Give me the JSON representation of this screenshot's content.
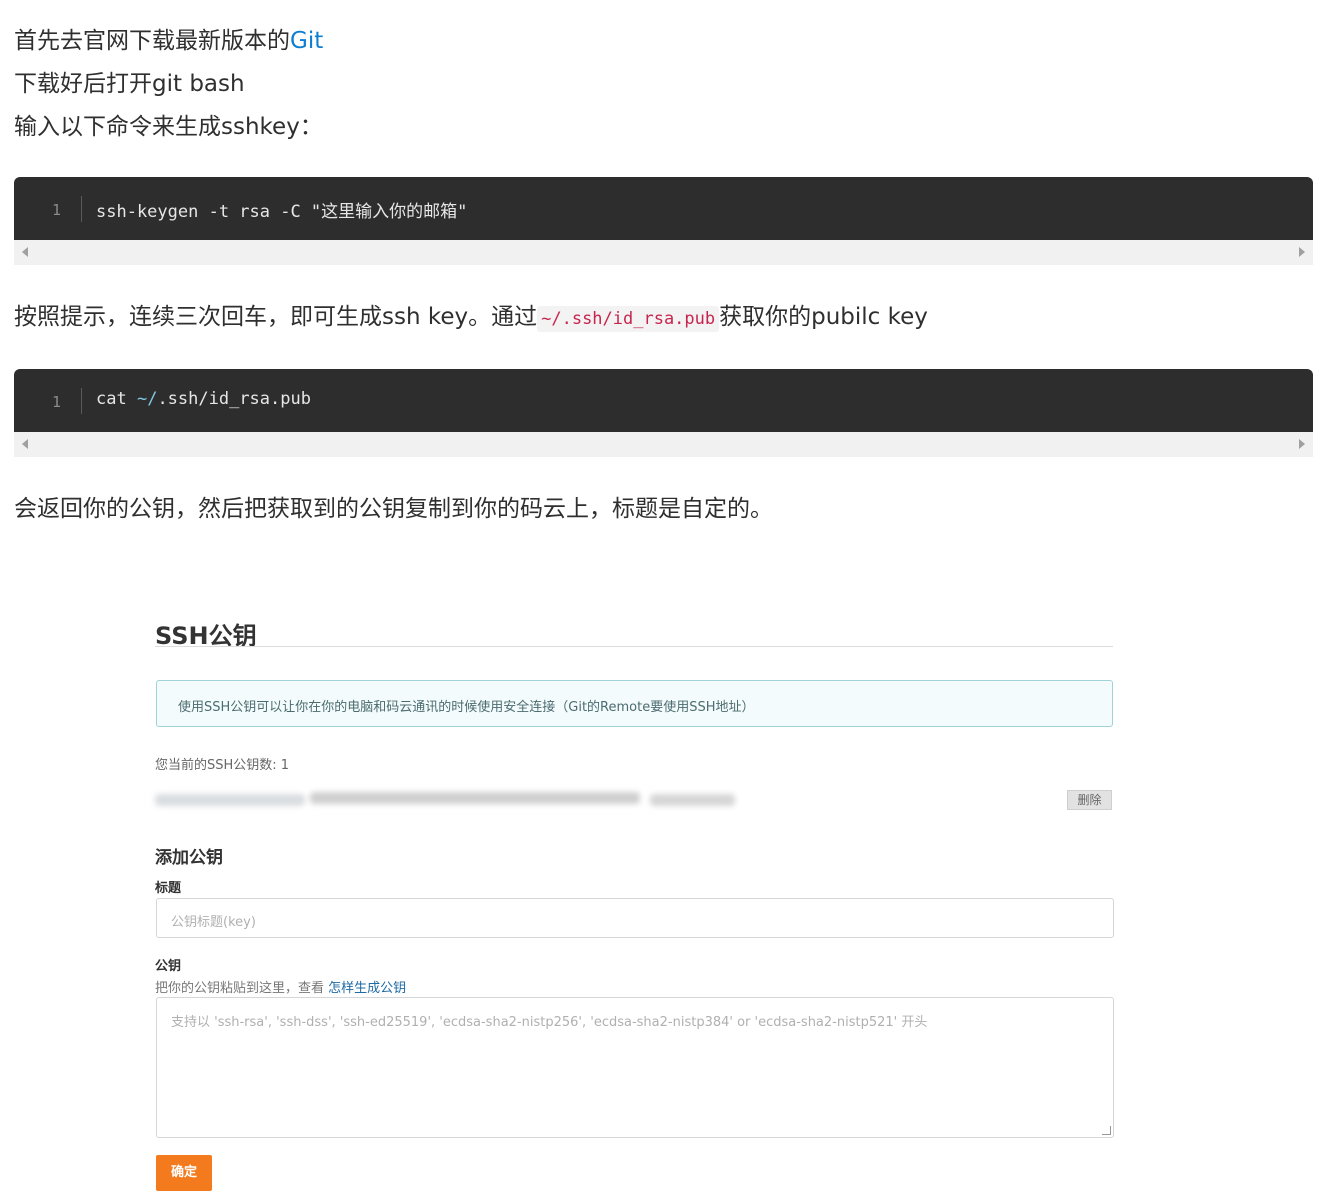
{
  "article": {
    "line1_prefix": "首先去官网下载最新版本的",
    "line1_link": "Git",
    "line2": "下载好后打开git bash",
    "line3": "输入以下命令来生成sshkey：",
    "para2_prefix": "按照提示，连续三次回车，即可生成ssh key。通过",
    "para2_code": "~/.ssh/id_rsa.pub",
    "para2_suffix": "获取你的pubilc key",
    "para3": "会返回你的公钥，然后把获取到的公钥复制到你的码云上，标题是自定的。"
  },
  "code_blocks": [
    {
      "line_number": "1",
      "code": "ssh-keygen -t rsa -C \"这里输入你的邮箱\""
    },
    {
      "line_number": "1",
      "code_prefix": "cat ",
      "code_path": "~/",
      "code_rest": ".ssh/id_rsa.pub"
    }
  ],
  "ssh_panel": {
    "title": "SSH公钥",
    "info": "使用SSH公钥可以让你在你的电脑和码云通讯的时候使用安全连接（Git的Remote要使用SSH地址）",
    "key_count": "您当前的SSH公钥数: 1",
    "delete_label": "删除",
    "add_heading": "添加公钥",
    "title_label": "标题",
    "title_placeholder": "公钥标题(key)",
    "key_label": "公钥",
    "key_hint": "把你的公钥粘贴到这里，查看 ",
    "key_hint_link": "怎样生成公钥",
    "key_placeholder": "支持以 'ssh-rsa', 'ssh-dss', 'ssh-ed25519', 'ecdsa-sha2-nistp256', 'ecdsa-sha2-nistp384' or 'ecdsa-sha2-nistp521' 开头",
    "submit_label": "确定"
  },
  "colors": {
    "link": "#0c7fd1",
    "code_bg": "#2d2d2d",
    "submit": "#f37b1d",
    "info_border": "#9fd3d8"
  }
}
